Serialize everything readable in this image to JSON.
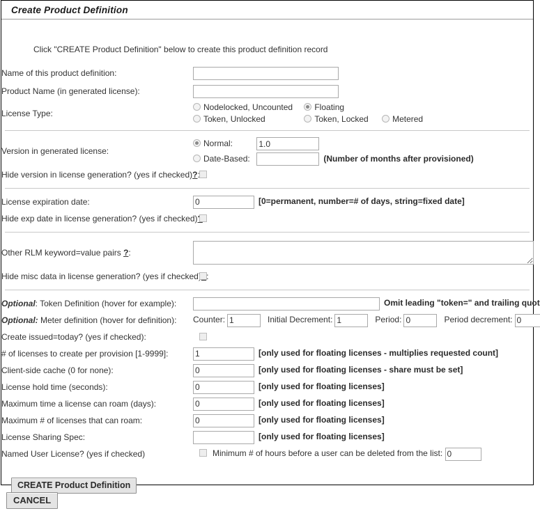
{
  "panel": {
    "title": "Create Product Definition",
    "intro": "Click \"CREATE Product Definition\" below to create this product definition record"
  },
  "fields": {
    "name_label": "Name of this product definition:",
    "name_value": "",
    "product_name_label": "Product Name (in generated license):",
    "product_name_value": "",
    "license_type_label": "License Type:",
    "license_type_options": [
      {
        "label": "Nodelocked, Uncounted",
        "checked": false
      },
      {
        "label": "Floating",
        "checked": true
      },
      {
        "label": "Token, Unlocked",
        "checked": false
      },
      {
        "label": "Token, Locked",
        "checked": false
      },
      {
        "label": "Metered",
        "checked": false
      }
    ],
    "version_label": "Version in generated license:",
    "version_normal_label": "Normal:",
    "version_normal_checked": true,
    "version_normal_value": "1.0",
    "version_date_label": "Date-Based:",
    "version_date_checked": false,
    "version_date_value": "",
    "version_date_hint": "(Number of months after provisioned)",
    "hide_version_label_pre": "Hide version in license generation? (yes if checked)",
    "hide_version_label_post": ":",
    "hide_version_checked": false,
    "exp_label": "License expiration date:",
    "exp_value": "0",
    "exp_hint": "[0=permanent, number=# of days, string=fixed date]",
    "hide_exp_label_pre": "Hide exp date in license generation? (yes if checked)",
    "hide_exp_label_post": ":",
    "hide_exp_checked": false,
    "rlm_label_pre": "Other RLM keyword=value pairs ",
    "rlm_label_post": ":",
    "rlm_value": "",
    "hide_misc_label_pre": "Hide misc data in license generation? (yes if checked)",
    "hide_misc_label_post": ":",
    "hide_misc_checked": false,
    "token_optional": "Optional",
    "token_label": ": Token Definition (hover for example):",
    "token_value": "",
    "token_hint": "Omit leading \"token=\" and trailing quote.",
    "meter_optional": "Optional:",
    "meter_label": " Meter definition (hover for definition):",
    "meter_counter_label": "Counter:",
    "meter_counter_value": "1",
    "meter_initial_decrement_label": "Initial Decrement:",
    "meter_initial_decrement_value": "1",
    "meter_period_label": "Period:",
    "meter_period_value": "0",
    "meter_period_decrement_label": "Period decrement:",
    "meter_period_decrement_value": "0",
    "issued_today_label": "Create issued=today? (yes if checked):",
    "issued_today_checked": false,
    "num_licenses_label": "# of licenses to create per provision [1-9999]:",
    "num_licenses_value": "1",
    "num_licenses_hint": "[only used for floating licenses - multiplies requested count]",
    "client_cache_label": "Client-side cache (0 for none):",
    "client_cache_value": "0",
    "client_cache_hint": "[only used for floating licenses - share must be set]",
    "hold_time_label": "License hold time (seconds):",
    "hold_time_value": "0",
    "hold_time_hint": "[only used for floating licenses]",
    "max_roam_time_label": "Maximum time a license can roam (days):",
    "max_roam_time_value": "0",
    "max_roam_time_hint": "[only used for floating licenses]",
    "max_roam_count_label": "Maximum # of licenses that can roam:",
    "max_roam_count_value": "0",
    "max_roam_count_hint": "[only used for floating licenses]",
    "sharing_spec_label": "License Sharing Spec:",
    "sharing_spec_value": "",
    "sharing_spec_hint": "[only used for floating licenses]",
    "named_user_label": "Named User License? (yes if checked)",
    "named_user_checked": false,
    "min_hours_label": "Minimum # of hours before a user can be deleted from the list:",
    "min_hours_value": "0"
  },
  "buttons": {
    "create": "CREATE Product Definition",
    "cancel": "CANCEL"
  },
  "colors": {
    "panel_border": "#000000",
    "rule": "#c8c8c8",
    "input_border": "#a9a9a9",
    "button_face": "#e4e4e4",
    "text": "#333333"
  }
}
